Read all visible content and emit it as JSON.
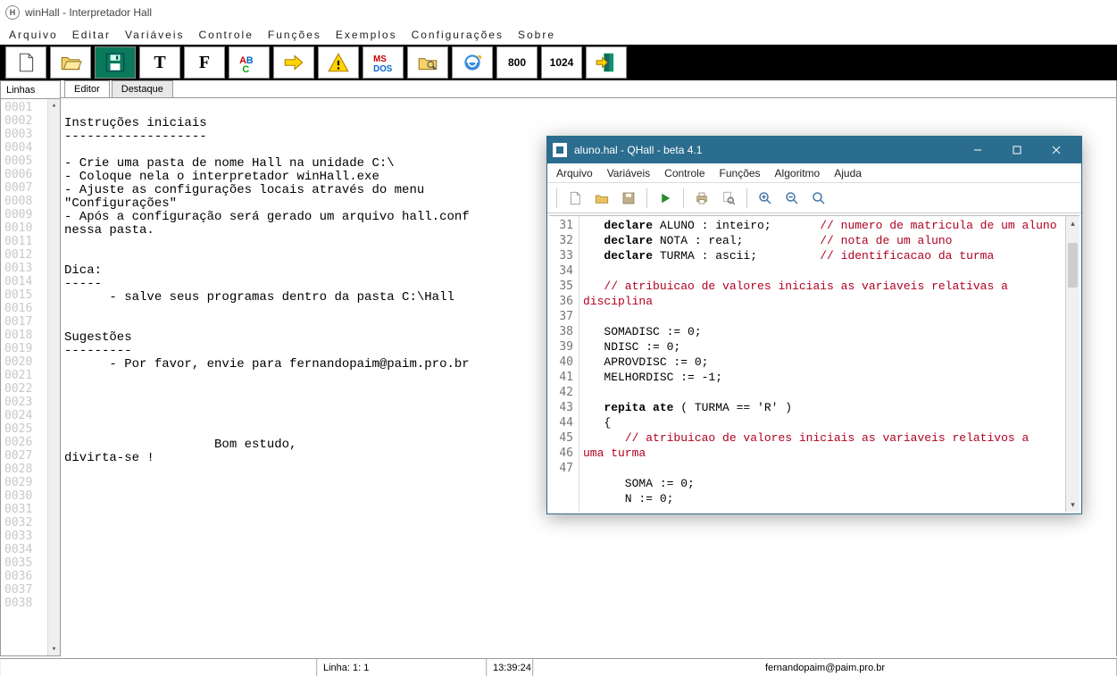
{
  "main": {
    "title": "winHall - Interpretador Hall",
    "menu": [
      "Arquivo",
      "Editar",
      "Variáveis",
      "Controle",
      "Funções",
      "Exemplos",
      "Configurações",
      "Sobre"
    ],
    "toolbar_nums": [
      "800",
      "1024"
    ],
    "left_tab": "Linhas",
    "tabs": [
      "Editor",
      "Destaque"
    ],
    "gutter_lines": [
      "0001",
      "0002",
      "0003",
      "0004",
      "0005",
      "0006",
      "0007",
      "0008",
      "0009",
      "0010",
      "0011",
      "0012",
      "0013",
      "0014",
      "0015",
      "0016",
      "0017",
      "0018",
      "0019",
      "0020",
      "0021",
      "0022",
      "0023",
      "0024",
      "0025",
      "0026",
      "0027",
      "0028",
      "0029",
      "0030",
      "0031",
      "0032",
      "0033",
      "0034",
      "0035",
      "0036",
      "0037",
      "0038"
    ],
    "editor_text": "\nInstruções iniciais\n-------------------\n\n- Crie uma pasta de nome Hall na unidade C:\\\n- Coloque nela o interpretador winHall.exe\n- Ajuste as configurações locais através do menu\n\"Configurações\"\n- Após a configuração será gerado um arquivo hall.conf\nnessa pasta.\n\n\nDica:\n-----\n      - salve seus programas dentro da pasta C:\\Hall\n\n\nSugestões\n---------\n      - Por favor, envie para fernandopaim@paim.pro.br\n\n\n\n\n\n                    Bom estudo,\ndivirta-se !",
    "status": {
      "linha": "Linha: 1: 1",
      "hora": "13:39:24",
      "email": "fernandopaim@paim.pro.br"
    }
  },
  "qhall": {
    "title": "aluno.hal - QHall - beta 4.1",
    "menu": [
      "Arquivo",
      "Variáveis",
      "Controle",
      "Funções",
      "Algoritmo",
      "Ajuda"
    ],
    "lines": [
      {
        "n": 31,
        "html": "   <span class='kw'>declare</span> ALUNO : inteiro;       <span class='cm'>// numero de matricula de um aluno</span>"
      },
      {
        "n": 32,
        "html": "   <span class='kw'>declare</span> NOTA : real;           <span class='cm'>// nota de um aluno</span>"
      },
      {
        "n": 33,
        "html": "   <span class='kw'>declare</span> TURMA : ascii;         <span class='cm'>// identificacao da turma</span>"
      },
      {
        "n": 34,
        "html": ""
      },
      {
        "n": 35,
        "html": "   <span class='cm'>// atribuicao de valores iniciais as variaveis relativas a</span>"
      },
      {
        "n": "",
        "html": "<span class='cm'>disciplina</span>"
      },
      {
        "n": 36,
        "html": ""
      },
      {
        "n": 37,
        "html": "   SOMADISC := 0;"
      },
      {
        "n": 38,
        "html": "   NDISC := 0;"
      },
      {
        "n": 39,
        "html": "   APROVDISC := 0;"
      },
      {
        "n": 40,
        "html": "   MELHORDISC := -1;"
      },
      {
        "n": 41,
        "html": ""
      },
      {
        "n": 42,
        "html": "   <span class='kw'>repita ate</span> ( TURMA == 'R' )"
      },
      {
        "n": 43,
        "html": "   {"
      },
      {
        "n": 44,
        "html": "      <span class='cm'>// atribuicao de valores iniciais as variaveis relativos a</span>"
      },
      {
        "n": "",
        "html": "<span class='cm'>uma turma</span>"
      },
      {
        "n": 45,
        "html": ""
      },
      {
        "n": 46,
        "html": "      SOMA := 0;"
      },
      {
        "n": 47,
        "html": "      N := 0;"
      }
    ]
  }
}
